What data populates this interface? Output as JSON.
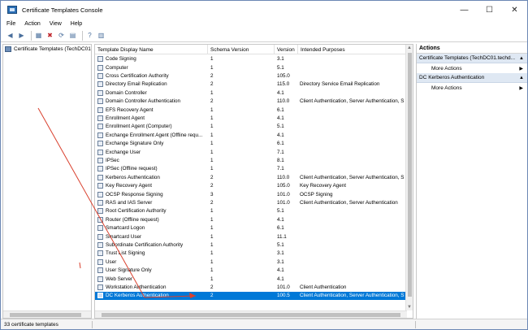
{
  "window": {
    "title": "Certificate Templates Console"
  },
  "window_controls": {
    "minimize": "—",
    "maximize": "☐",
    "close": "✕"
  },
  "menu": [
    "File",
    "Action",
    "View",
    "Help"
  ],
  "tree": {
    "root_label": "Certificate Templates (TechDC01"
  },
  "columns": [
    "Template Display Name",
    "Schema Version",
    "Version",
    "Intended Purposes"
  ],
  "rows": [
    {
      "name": "Code Signing",
      "schema": "1",
      "version": "3.1",
      "purposes": ""
    },
    {
      "name": "Computer",
      "schema": "1",
      "version": "5.1",
      "purposes": ""
    },
    {
      "name": "Cross Certification Authority",
      "schema": "2",
      "version": "105.0",
      "purposes": ""
    },
    {
      "name": "Directory Email Replication",
      "schema": "2",
      "version": "115.0",
      "purposes": "Directory Service Email Replication"
    },
    {
      "name": "Domain Controller",
      "schema": "1",
      "version": "4.1",
      "purposes": ""
    },
    {
      "name": "Domain Controller Authentication",
      "schema": "2",
      "version": "110.0",
      "purposes": "Client Authentication, Server Authentication, S"
    },
    {
      "name": "EFS Recovery Agent",
      "schema": "1",
      "version": "6.1",
      "purposes": ""
    },
    {
      "name": "Enrollment Agent",
      "schema": "1",
      "version": "4.1",
      "purposes": ""
    },
    {
      "name": "Enrollment Agent (Computer)",
      "schema": "1",
      "version": "5.1",
      "purposes": ""
    },
    {
      "name": "Exchange Enrollment Agent (Offline requ...",
      "schema": "1",
      "version": "4.1",
      "purposes": ""
    },
    {
      "name": "Exchange Signature Only",
      "schema": "1",
      "version": "6.1",
      "purposes": ""
    },
    {
      "name": "Exchange User",
      "schema": "1",
      "version": "7.1",
      "purposes": ""
    },
    {
      "name": "IPSec",
      "schema": "1",
      "version": "8.1",
      "purposes": ""
    },
    {
      "name": "IPSec (Offline request)",
      "schema": "1",
      "version": "7.1",
      "purposes": ""
    },
    {
      "name": "Kerberos Authentication",
      "schema": "2",
      "version": "110.0",
      "purposes": "Client Authentication, Server Authentication, S"
    },
    {
      "name": "Key Recovery Agent",
      "schema": "2",
      "version": "105.0",
      "purposes": "Key Recovery Agent"
    },
    {
      "name": "OCSP Response Signing",
      "schema": "3",
      "version": "101.0",
      "purposes": "OCSP Signing"
    },
    {
      "name": "RAS and IAS Server",
      "schema": "2",
      "version": "101.0",
      "purposes": "Client Authentication, Server Authentication"
    },
    {
      "name": "Root Certification Authority",
      "schema": "1",
      "version": "5.1",
      "purposes": ""
    },
    {
      "name": "Router (Offline request)",
      "schema": "1",
      "version": "4.1",
      "purposes": ""
    },
    {
      "name": "Smartcard Logon",
      "schema": "1",
      "version": "6.1",
      "purposes": ""
    },
    {
      "name": "Smartcard User",
      "schema": "1",
      "version": "11.1",
      "purposes": ""
    },
    {
      "name": "Subordinate Certification Authority",
      "schema": "1",
      "version": "5.1",
      "purposes": ""
    },
    {
      "name": "Trust List Signing",
      "schema": "1",
      "version": "3.1",
      "purposes": ""
    },
    {
      "name": "User",
      "schema": "1",
      "version": "3.1",
      "purposes": ""
    },
    {
      "name": "User Signature Only",
      "schema": "1",
      "version": "4.1",
      "purposes": ""
    },
    {
      "name": "Web Server",
      "schema": "1",
      "version": "4.1",
      "purposes": ""
    },
    {
      "name": "Workstation Authentication",
      "schema": "2",
      "version": "101.0",
      "purposes": "Client Authentication"
    },
    {
      "name": "DC Kerberos Authentication",
      "schema": "2",
      "version": "100.5",
      "purposes": "Client Authentication, Server Authentication, S"
    }
  ],
  "selected_row_index": 28,
  "actions": {
    "title": "Actions",
    "sections": [
      {
        "header": "Certificate Templates (TechDC01.techd...",
        "items": [
          "More Actions"
        ]
      },
      {
        "header": "DC Kerberos Authentication",
        "items": [
          "More Actions"
        ]
      }
    ]
  },
  "status": {
    "text": "33 certificate templates"
  },
  "colors": {
    "selection": "#0078d7",
    "annotation": "#d9402e",
    "actions_header": "#dfe8f3"
  }
}
